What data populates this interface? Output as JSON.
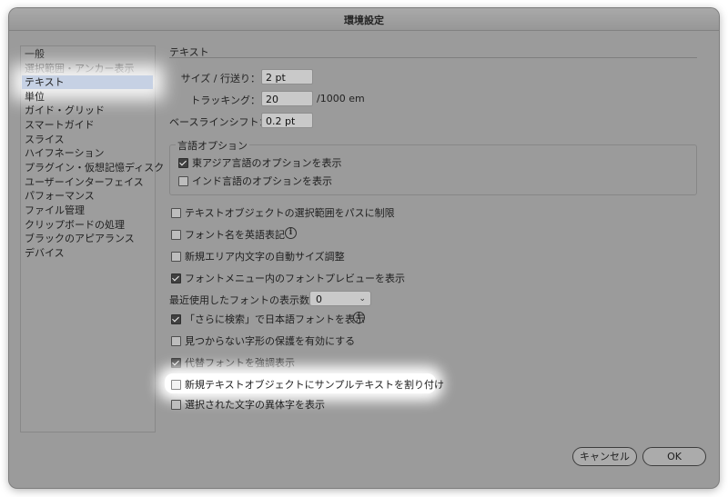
{
  "window": {
    "title": "環境設定"
  },
  "sidebar": {
    "items": [
      {
        "label": "一般"
      },
      {
        "label": "選択範囲・アンカー表示"
      },
      {
        "label": "テキスト",
        "selected": true
      },
      {
        "label": "単位"
      },
      {
        "label": "ガイド・グリッド"
      },
      {
        "label": "スマートガイド"
      },
      {
        "label": "スライス"
      },
      {
        "label": "ハイフネーション"
      },
      {
        "label": "プラグイン・仮想記憶ディスク"
      },
      {
        "label": "ユーザーインターフェイス"
      },
      {
        "label": "パフォーマンス"
      },
      {
        "label": "ファイル管理"
      },
      {
        "label": "クリップボードの処理"
      },
      {
        "label": "ブラックのアピアランス"
      },
      {
        "label": "デバイス"
      }
    ]
  },
  "panel": {
    "section_title": "テキスト",
    "size_leading": {
      "label": "サイズ / 行送り：",
      "value": "2 pt"
    },
    "tracking": {
      "label": "トラッキング：",
      "value": "20",
      "unit": "/1000 em"
    },
    "baseline_shift": {
      "label": "ベースラインシフト：",
      "value": "0.2 pt"
    },
    "language_options": {
      "title": "言語オプション",
      "east_asian": {
        "label": "東アジア言語のオプションを表示",
        "checked": true
      },
      "indic": {
        "label": "インド言語のオプションを表示",
        "checked": false
      }
    },
    "options": {
      "text_object_selection": {
        "label": "テキストオブジェクトの選択範囲をパスに制限",
        "checked": false
      },
      "font_names_english": {
        "label": "フォント名を英語表記",
        "checked": false
      },
      "auto_size_area": {
        "label": "新規エリア内文字の自動サイズ調整",
        "checked": false
      },
      "font_menu_preview": {
        "label": "フォントメニュー内のフォントプレビューを表示",
        "checked": true
      },
      "more_search_japanese": {
        "label": "「さらに検索」で日本語フォントを表示",
        "checked": true
      },
      "missing_glyph_protection": {
        "label": "見つからない字形の保護を有効にする",
        "checked": false
      },
      "highlight_substituted": {
        "label": "代替フォントを強調表示",
        "checked": true
      },
      "fill_placeholder_text": {
        "label": "新規テキストオブジェクトにサンプルテキストを割り付け",
        "checked": false
      },
      "alternate_glyphs": {
        "label": "選択された文字の異体字を表示",
        "checked": false
      }
    },
    "recent_fonts": {
      "label": "最近使用したフォントの表示数：",
      "value": "0"
    }
  },
  "buttons": {
    "cancel": "キャンセル",
    "ok": "OK"
  },
  "icons": {
    "info": "info-icon",
    "dropdown": "chevron-down-icon",
    "check": "checkmark-icon"
  },
  "colors": {
    "window_bg": "#9b9b9b",
    "selected_item": "#c6d1e4",
    "highlight": "#ffffff"
  }
}
